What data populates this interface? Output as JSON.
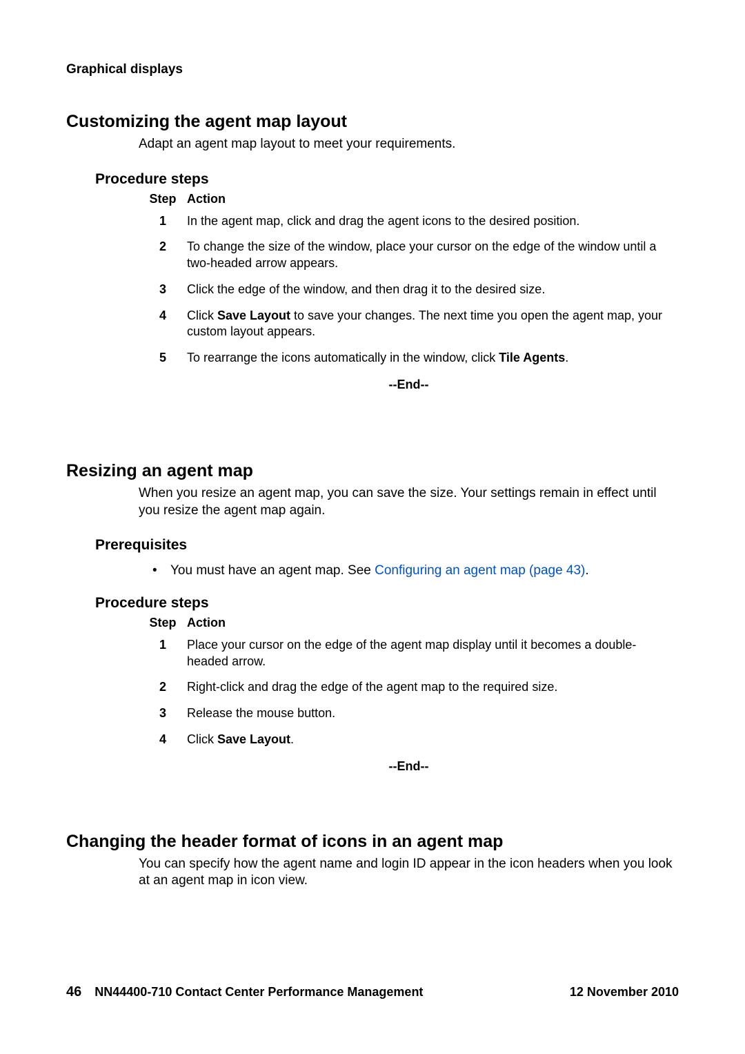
{
  "header": {
    "running": "Graphical displays"
  },
  "section1": {
    "title": "Customizing the agent map layout",
    "intro": "Adapt an agent map layout to meet your requirements.",
    "proc_title": "Procedure steps",
    "col_step": "Step",
    "col_action": "Action",
    "steps": {
      "n1": "1",
      "a1": "In the agent map, click and drag the agent icons to the desired position.",
      "n2": "2",
      "a2": "To change the size of the window, place your cursor on the edge of the window until a two-headed arrow appears.",
      "n3": "3",
      "a3": "Click the edge of the window, and then drag it to the desired size.",
      "n4": "4",
      "a4_pre": "Click ",
      "a4_bold": "Save Layout",
      "a4_post": " to save your changes. The next time you open the agent map, your custom layout appears.",
      "n5": "5",
      "a5_pre": "To rearrange the icons automatically in the window, click ",
      "a5_bold": "Tile Agents",
      "a5_post": "."
    },
    "end": "--End--"
  },
  "section2": {
    "title": "Resizing an agent map",
    "intro": "When you resize an agent map, you can save the size. Your settings remain in effect until you resize the agent map again.",
    "prereq_title": "Prerequisites",
    "bullet_dot": "•",
    "prereq_text": "You must have an agent map. See ",
    "prereq_link": "Configuring an agent map (page 43)",
    "prereq_post": ".",
    "proc_title": "Procedure steps",
    "col_step": "Step",
    "col_action": "Action",
    "steps": {
      "n1": "1",
      "a1": "Place your cursor on the edge of the agent map display until it becomes a double-headed arrow.",
      "n2": "2",
      "a2": "Right-click and drag the edge of the agent map to the required size.",
      "n3": "3",
      "a3": "Release the mouse button.",
      "n4": "4",
      "a4_pre": "Click ",
      "a4_bold": "Save Layout",
      "a4_post": "."
    },
    "end": "--End--"
  },
  "section3": {
    "title": "Changing the header format of icons in an agent map",
    "intro": "You can specify how the agent name and login ID appear in the icon headers when you look at an agent map in icon view."
  },
  "footer": {
    "page": "46",
    "doc": "NN44400-710 Contact Center Performance Management",
    "date": "12 November 2010"
  }
}
